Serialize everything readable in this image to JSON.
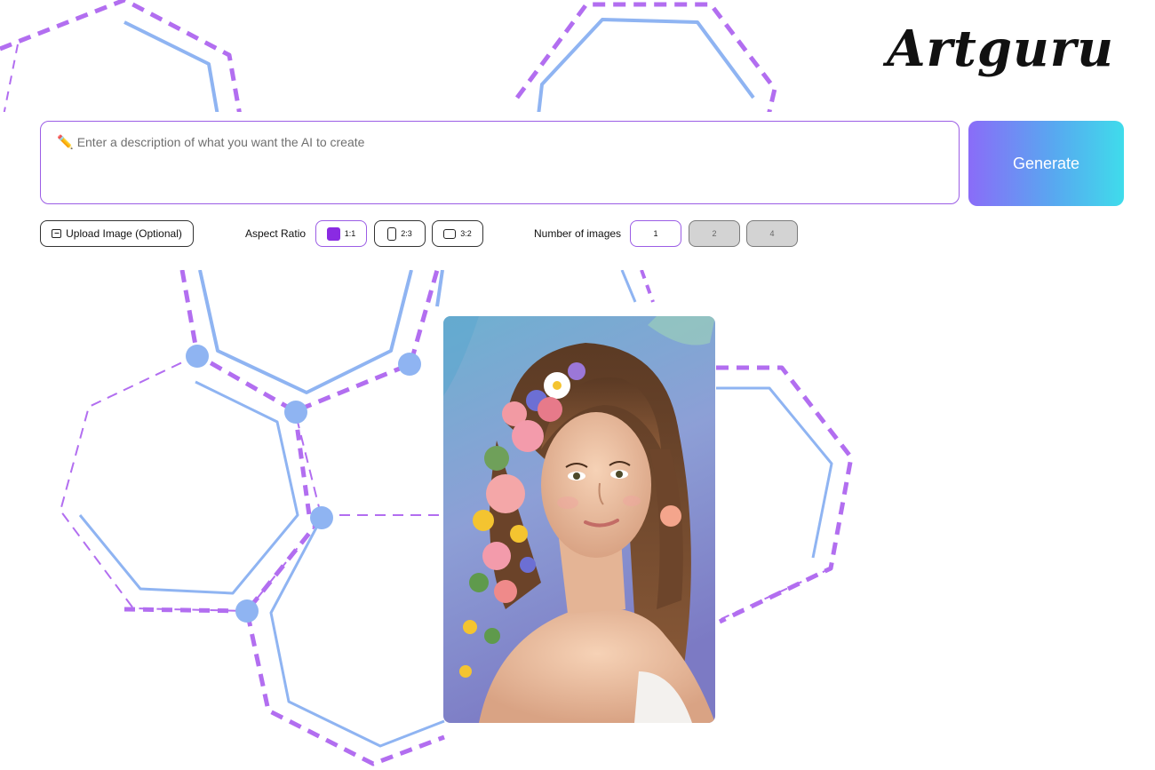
{
  "brand": {
    "logo_text": "Artguru"
  },
  "prompt": {
    "placeholder": "Enter a description of what you want the AI to create"
  },
  "generate_button": {
    "label": "Generate"
  },
  "upload": {
    "label": "Upload Image (Optional)"
  },
  "aspect_ratio": {
    "label": "Aspect Ratio",
    "options": [
      {
        "label": "1:1",
        "selected": true
      },
      {
        "label": "2:3",
        "selected": false
      },
      {
        "label": "3:2",
        "selected": false
      }
    ]
  },
  "number_of_images": {
    "label": "Number of images",
    "options": [
      {
        "label": "1",
        "selected": true,
        "enabled": true
      },
      {
        "label": "2",
        "selected": false,
        "enabled": false
      },
      {
        "label": "4",
        "selected": false,
        "enabled": false
      }
    ]
  },
  "colors": {
    "accent_purple": "#9b5de5",
    "generate_gradient_start": "#8a6cf8",
    "generate_gradient_end": "#3fdceb",
    "hex_blue": "#8fb4f2",
    "hex_dash": "#b26ef0"
  },
  "result_image": {
    "subject": "portrait of young woman with flower crown"
  }
}
